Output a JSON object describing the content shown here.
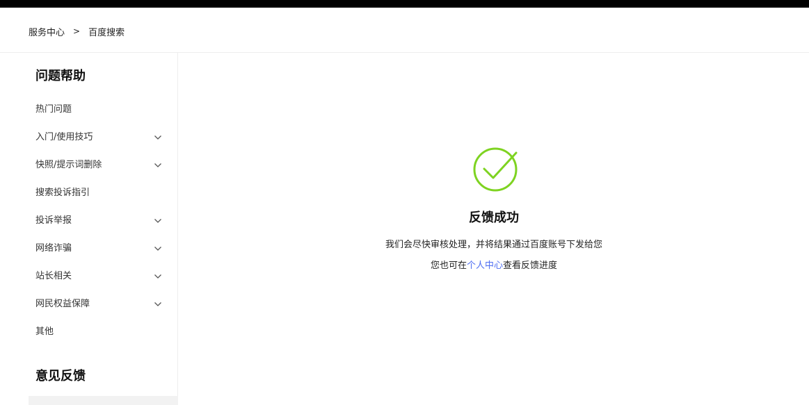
{
  "breadcrumb": {
    "home": "服务中心",
    "separator": ">",
    "current": "百度搜索"
  },
  "sidebar": {
    "help_title": "问题帮助",
    "items": [
      {
        "label": "热门问题",
        "expandable": false
      },
      {
        "label": "入门/使用技巧",
        "expandable": true
      },
      {
        "label": "快照/提示词删除",
        "expandable": true
      },
      {
        "label": "搜索投诉指引",
        "expandable": false
      },
      {
        "label": "投诉举报",
        "expandable": true
      },
      {
        "label": "网络诈骗",
        "expandable": true
      },
      {
        "label": "站长相关",
        "expandable": true
      },
      {
        "label": "网民权益保障",
        "expandable": true
      },
      {
        "label": "其他",
        "expandable": false
      }
    ],
    "feedback_title": "意见反馈"
  },
  "main": {
    "icon": "check-circle-icon",
    "title": "反馈成功",
    "message1": "我们会尽快审核处理，并将结果通过百度账号下发给您",
    "message2_prefix": "您也可在",
    "message2_link": "个人中心",
    "message2_suffix": "查看反馈进度"
  },
  "colors": {
    "success": "#7ed321",
    "link": "#4e6ef2",
    "topbar": "#000000"
  }
}
